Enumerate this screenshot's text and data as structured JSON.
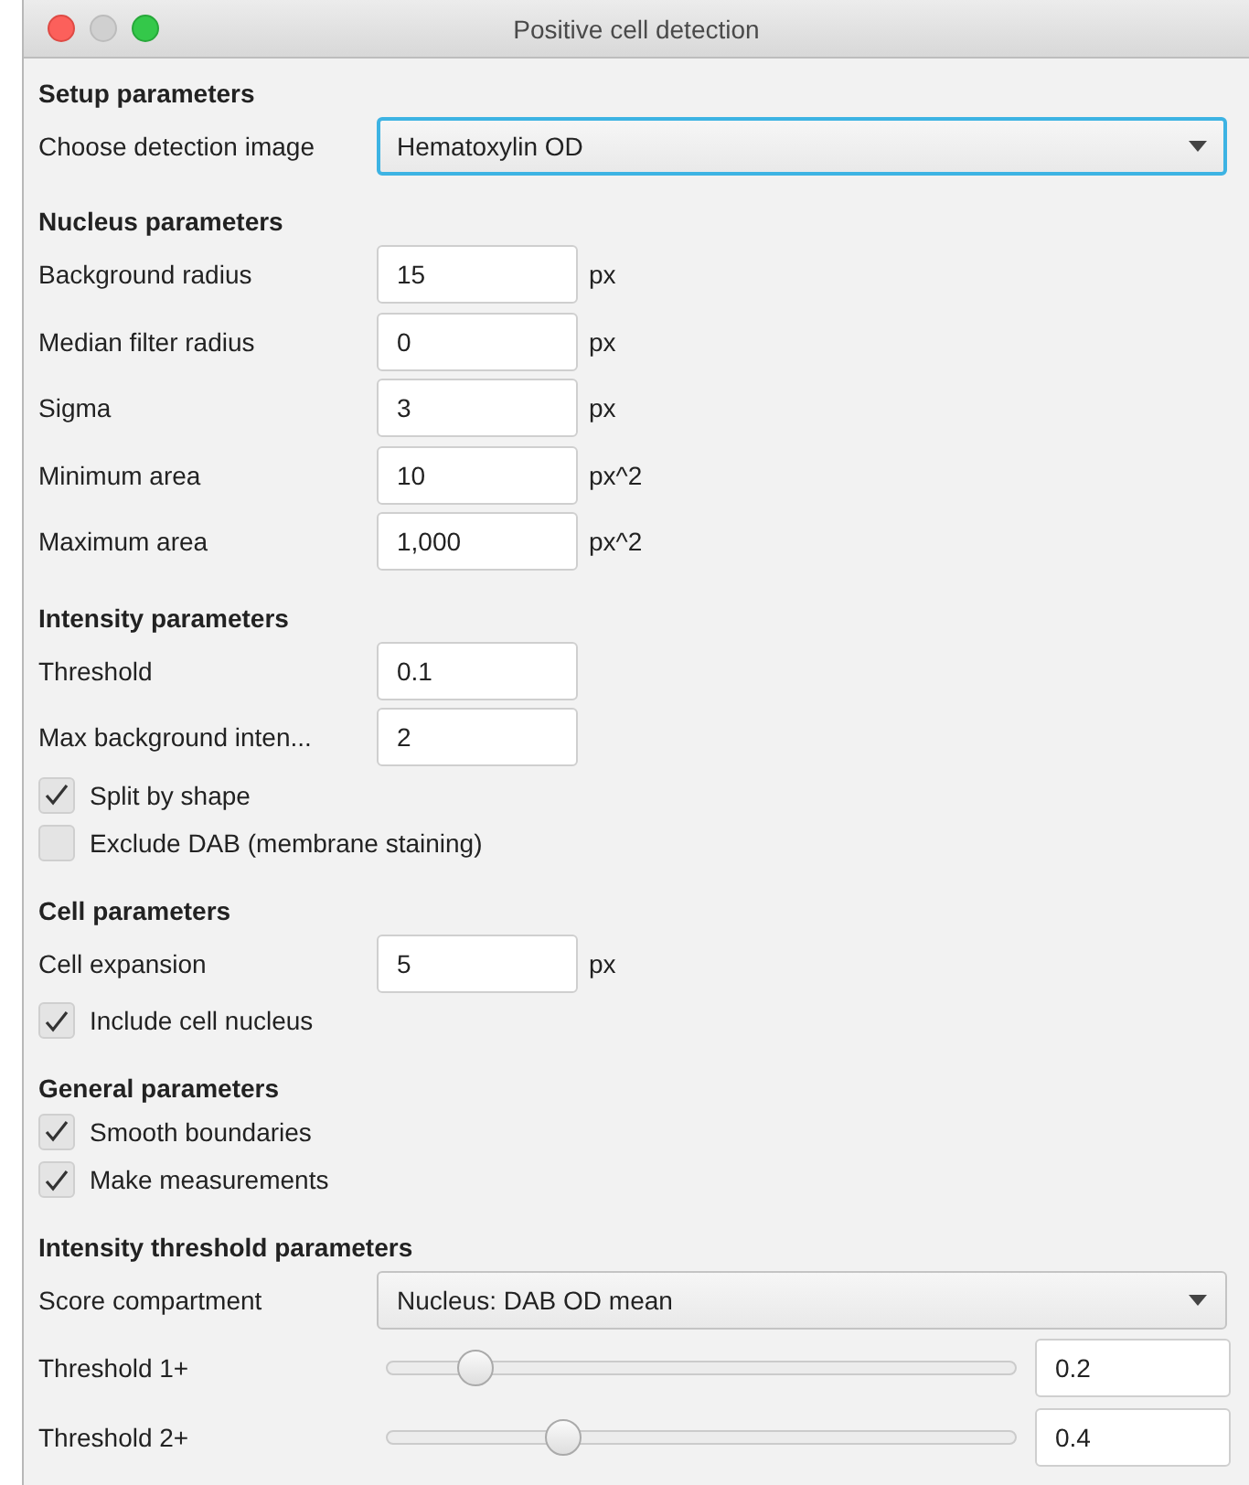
{
  "window": {
    "title": "Positive cell detection"
  },
  "sections": [
    {
      "title": "Setup parameters",
      "rows": [
        {
          "kind": "dropdown",
          "label": "Choose detection image",
          "value": "Hematoxylin OD",
          "focused": true
        }
      ]
    },
    {
      "title": "Nucleus parameters",
      "rows": [
        {
          "kind": "field",
          "label": "Background radius",
          "value": "15",
          "unit": "px"
        },
        {
          "kind": "field",
          "label": "Median filter radius",
          "value": "0",
          "unit": "px"
        },
        {
          "kind": "field",
          "label": "Sigma",
          "value": "3",
          "unit": "px"
        },
        {
          "kind": "field",
          "label": "Minimum area",
          "value": "10",
          "unit": "px^2"
        },
        {
          "kind": "field",
          "label": "Maximum area",
          "value": "1,000",
          "unit": "px^2"
        }
      ]
    },
    {
      "title": "Intensity parameters",
      "rows": [
        {
          "kind": "field",
          "label": "Threshold",
          "value": "0.1"
        },
        {
          "kind": "field",
          "label": "Max background inten...",
          "value": "2"
        },
        {
          "kind": "checkbox",
          "label": "Split by shape",
          "checked": true
        },
        {
          "kind": "checkbox",
          "label": "Exclude DAB (membrane staining)",
          "checked": false
        }
      ]
    },
    {
      "title": "Cell parameters",
      "rows": [
        {
          "kind": "field",
          "label": "Cell expansion",
          "value": "5",
          "unit": "px"
        },
        {
          "kind": "checkbox",
          "label": "Include cell nucleus",
          "checked": true
        }
      ]
    },
    {
      "title": "General parameters",
      "rows": [
        {
          "kind": "checkbox",
          "label": "Smooth boundaries",
          "checked": true
        },
        {
          "kind": "checkbox",
          "label": "Make measurements",
          "checked": true
        }
      ]
    },
    {
      "title": "Intensity threshold parameters",
      "rows": [
        {
          "kind": "dropdown",
          "label": "Score compartment",
          "value": "Nucleus: DAB OD mean",
          "focused": false
        },
        {
          "kind": "slider",
          "label": "Threshold 1+",
          "level": 0.14,
          "value": "0.2"
        },
        {
          "kind": "slider",
          "label": "Threshold 2+",
          "level": 0.28,
          "value": "0.4"
        }
      ]
    }
  ]
}
